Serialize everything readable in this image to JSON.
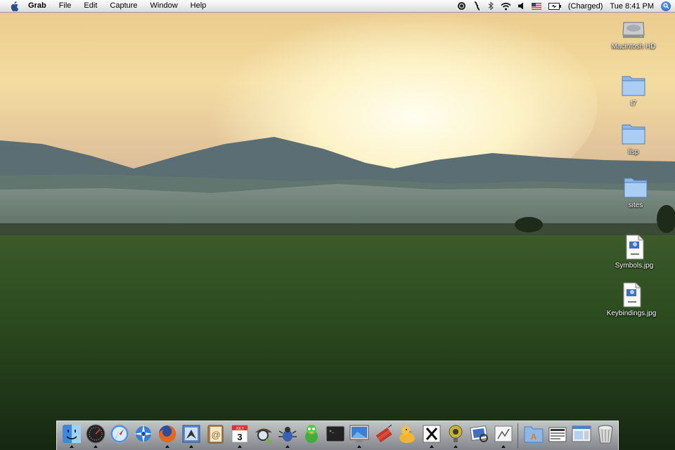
{
  "menubar": {
    "app_name": "Grab",
    "menus": [
      "File",
      "Edit",
      "Capture",
      "Window",
      "Help"
    ],
    "battery_status": "(Charged)",
    "clock": "Tue 8:41 PM"
  },
  "desktop_icons": [
    {
      "label": "Macintosh HD",
      "icon": "hard-drive-icon"
    },
    {
      "label": "t7",
      "icon": "folder-icon"
    },
    {
      "label": "lisp",
      "icon": "folder-icon"
    },
    {
      "label": "sites",
      "icon": "folder-icon"
    },
    {
      "label": "Symbols.jpg",
      "icon": "jpeg-file-icon"
    },
    {
      "label": "Keybindings.jpg",
      "icon": "jpeg-file-icon"
    }
  ],
  "dock": {
    "calendar_day": "3",
    "calendar_month": "JULY",
    "items": [
      {
        "icon": "finder-icon",
        "running": true
      },
      {
        "icon": "dashboard-icon",
        "running": true
      },
      {
        "icon": "safari-icon",
        "running": false
      },
      {
        "icon": "network-utility-icon",
        "running": false
      },
      {
        "icon": "firefox-icon",
        "running": true
      },
      {
        "icon": "mail-icon",
        "running": true
      },
      {
        "icon": "address-book-icon",
        "running": false
      },
      {
        "icon": "ical-icon",
        "running": true
      },
      {
        "icon": "sherlock-icon",
        "running": false
      },
      {
        "icon": "bug-app-icon",
        "running": true
      },
      {
        "icon": "adium-icon",
        "running": false
      },
      {
        "icon": "terminal-icon",
        "running": false
      },
      {
        "icon": "screen-sharing-icon",
        "running": true
      },
      {
        "icon": "dynamite-icon",
        "running": false
      },
      {
        "icon": "cyberduck-icon",
        "running": false
      },
      {
        "icon": "x11-icon",
        "running": true
      },
      {
        "icon": "system-tool-icon",
        "running": true
      },
      {
        "icon": "preview-icon",
        "running": false
      },
      {
        "icon": "grab-icon",
        "running": true
      }
    ],
    "right_items": [
      {
        "icon": "applications-folder-icon"
      },
      {
        "icon": "documents-stack-icon"
      },
      {
        "icon": "window-stack-icon"
      },
      {
        "icon": "trash-icon"
      }
    ]
  },
  "colors": {
    "sky_top": "#f3cf7a",
    "sun": "#fffbe0",
    "mountains": "#5e7176",
    "field": "#2d4a22"
  }
}
